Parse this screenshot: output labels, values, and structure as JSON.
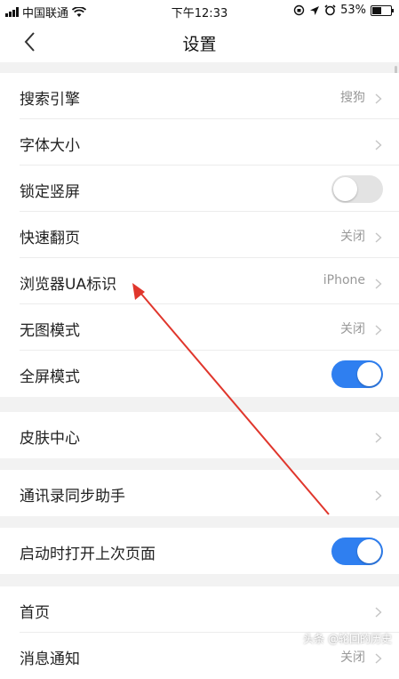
{
  "status_bar": {
    "carrier": "中国联通",
    "time": "下午12:33",
    "battery": "53%",
    "battery_level": 0.53
  },
  "nav": {
    "title": "设置",
    "back_icon": "chevron-left-icon"
  },
  "groups": [
    {
      "rows": [
        {
          "label": "搜索引擎",
          "value": "搜狗",
          "control": "chevron"
        },
        {
          "label": "字体大小",
          "value": "",
          "control": "chevron"
        },
        {
          "label": "锁定竖屏",
          "control": "toggle",
          "state": "off"
        },
        {
          "label": "快速翻页",
          "value": "关闭",
          "control": "chevron"
        },
        {
          "label": "浏览器UA标识",
          "value": "iPhone",
          "control": "chevron"
        },
        {
          "label": "无图模式",
          "value": "关闭",
          "control": "chevron"
        },
        {
          "label": "全屏模式",
          "control": "toggle",
          "state": "on"
        }
      ]
    },
    {
      "rows": [
        {
          "label": "皮肤中心",
          "value": "",
          "control": "chevron"
        }
      ]
    },
    {
      "rows": [
        {
          "label": "通讯录同步助手",
          "value": "",
          "control": "chevron"
        }
      ]
    },
    {
      "rows": [
        {
          "label": "启动时打开上次页面",
          "control": "toggle",
          "state": "on"
        }
      ]
    },
    {
      "rows": [
        {
          "label": "首页",
          "value": "",
          "control": "chevron"
        },
        {
          "label": "消息通知",
          "value": "关闭",
          "control": "chevron"
        }
      ]
    }
  ],
  "watermark": "头条 @轮回的历史",
  "colors": {
    "toggle_on": "#2f7ff0",
    "toggle_off": "#e3e3e3",
    "annotation_arrow": "#e0362c"
  }
}
